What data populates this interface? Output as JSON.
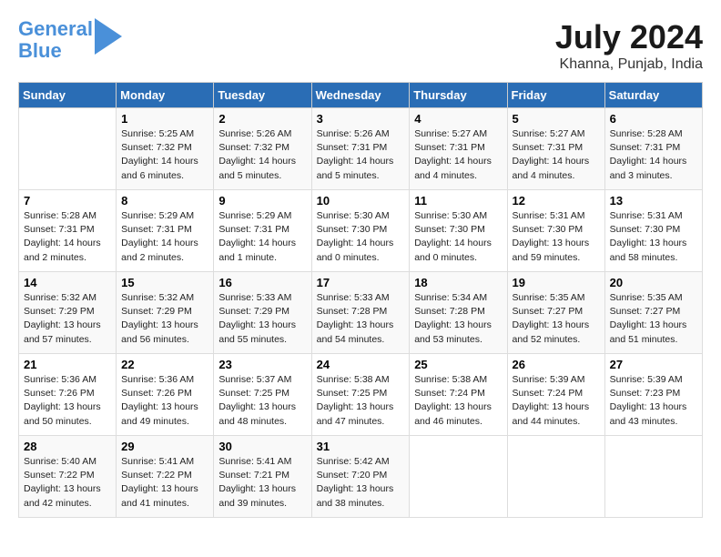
{
  "logo": {
    "line1": "General",
    "line2": "Blue"
  },
  "title": "July 2024",
  "location": "Khanna, Punjab, India",
  "headers": [
    "Sunday",
    "Monday",
    "Tuesday",
    "Wednesday",
    "Thursday",
    "Friday",
    "Saturday"
  ],
  "weeks": [
    [
      {
        "day": "",
        "info": ""
      },
      {
        "day": "1",
        "info": "Sunrise: 5:25 AM\nSunset: 7:32 PM\nDaylight: 14 hours\nand 6 minutes."
      },
      {
        "day": "2",
        "info": "Sunrise: 5:26 AM\nSunset: 7:32 PM\nDaylight: 14 hours\nand 5 minutes."
      },
      {
        "day": "3",
        "info": "Sunrise: 5:26 AM\nSunset: 7:31 PM\nDaylight: 14 hours\nand 5 minutes."
      },
      {
        "day": "4",
        "info": "Sunrise: 5:27 AM\nSunset: 7:31 PM\nDaylight: 14 hours\nand 4 minutes."
      },
      {
        "day": "5",
        "info": "Sunrise: 5:27 AM\nSunset: 7:31 PM\nDaylight: 14 hours\nand 4 minutes."
      },
      {
        "day": "6",
        "info": "Sunrise: 5:28 AM\nSunset: 7:31 PM\nDaylight: 14 hours\nand 3 minutes."
      }
    ],
    [
      {
        "day": "7",
        "info": "Sunrise: 5:28 AM\nSunset: 7:31 PM\nDaylight: 14 hours\nand 2 minutes."
      },
      {
        "day": "8",
        "info": "Sunrise: 5:29 AM\nSunset: 7:31 PM\nDaylight: 14 hours\nand 2 minutes."
      },
      {
        "day": "9",
        "info": "Sunrise: 5:29 AM\nSunset: 7:31 PM\nDaylight: 14 hours\nand 1 minute."
      },
      {
        "day": "10",
        "info": "Sunrise: 5:30 AM\nSunset: 7:30 PM\nDaylight: 14 hours\nand 0 minutes."
      },
      {
        "day": "11",
        "info": "Sunrise: 5:30 AM\nSunset: 7:30 PM\nDaylight: 14 hours\nand 0 minutes."
      },
      {
        "day": "12",
        "info": "Sunrise: 5:31 AM\nSunset: 7:30 PM\nDaylight: 13 hours\nand 59 minutes."
      },
      {
        "day": "13",
        "info": "Sunrise: 5:31 AM\nSunset: 7:30 PM\nDaylight: 13 hours\nand 58 minutes."
      }
    ],
    [
      {
        "day": "14",
        "info": "Sunrise: 5:32 AM\nSunset: 7:29 PM\nDaylight: 13 hours\nand 57 minutes."
      },
      {
        "day": "15",
        "info": "Sunrise: 5:32 AM\nSunset: 7:29 PM\nDaylight: 13 hours\nand 56 minutes."
      },
      {
        "day": "16",
        "info": "Sunrise: 5:33 AM\nSunset: 7:29 PM\nDaylight: 13 hours\nand 55 minutes."
      },
      {
        "day": "17",
        "info": "Sunrise: 5:33 AM\nSunset: 7:28 PM\nDaylight: 13 hours\nand 54 minutes."
      },
      {
        "day": "18",
        "info": "Sunrise: 5:34 AM\nSunset: 7:28 PM\nDaylight: 13 hours\nand 53 minutes."
      },
      {
        "day": "19",
        "info": "Sunrise: 5:35 AM\nSunset: 7:27 PM\nDaylight: 13 hours\nand 52 minutes."
      },
      {
        "day": "20",
        "info": "Sunrise: 5:35 AM\nSunset: 7:27 PM\nDaylight: 13 hours\nand 51 minutes."
      }
    ],
    [
      {
        "day": "21",
        "info": "Sunrise: 5:36 AM\nSunset: 7:26 PM\nDaylight: 13 hours\nand 50 minutes."
      },
      {
        "day": "22",
        "info": "Sunrise: 5:36 AM\nSunset: 7:26 PM\nDaylight: 13 hours\nand 49 minutes."
      },
      {
        "day": "23",
        "info": "Sunrise: 5:37 AM\nSunset: 7:25 PM\nDaylight: 13 hours\nand 48 minutes."
      },
      {
        "day": "24",
        "info": "Sunrise: 5:38 AM\nSunset: 7:25 PM\nDaylight: 13 hours\nand 47 minutes."
      },
      {
        "day": "25",
        "info": "Sunrise: 5:38 AM\nSunset: 7:24 PM\nDaylight: 13 hours\nand 46 minutes."
      },
      {
        "day": "26",
        "info": "Sunrise: 5:39 AM\nSunset: 7:24 PM\nDaylight: 13 hours\nand 44 minutes."
      },
      {
        "day": "27",
        "info": "Sunrise: 5:39 AM\nSunset: 7:23 PM\nDaylight: 13 hours\nand 43 minutes."
      }
    ],
    [
      {
        "day": "28",
        "info": "Sunrise: 5:40 AM\nSunset: 7:22 PM\nDaylight: 13 hours\nand 42 minutes."
      },
      {
        "day": "29",
        "info": "Sunrise: 5:41 AM\nSunset: 7:22 PM\nDaylight: 13 hours\nand 41 minutes."
      },
      {
        "day": "30",
        "info": "Sunrise: 5:41 AM\nSunset: 7:21 PM\nDaylight: 13 hours\nand 39 minutes."
      },
      {
        "day": "31",
        "info": "Sunrise: 5:42 AM\nSunset: 7:20 PM\nDaylight: 13 hours\nand 38 minutes."
      },
      {
        "day": "",
        "info": ""
      },
      {
        "day": "",
        "info": ""
      },
      {
        "day": "",
        "info": ""
      }
    ]
  ]
}
